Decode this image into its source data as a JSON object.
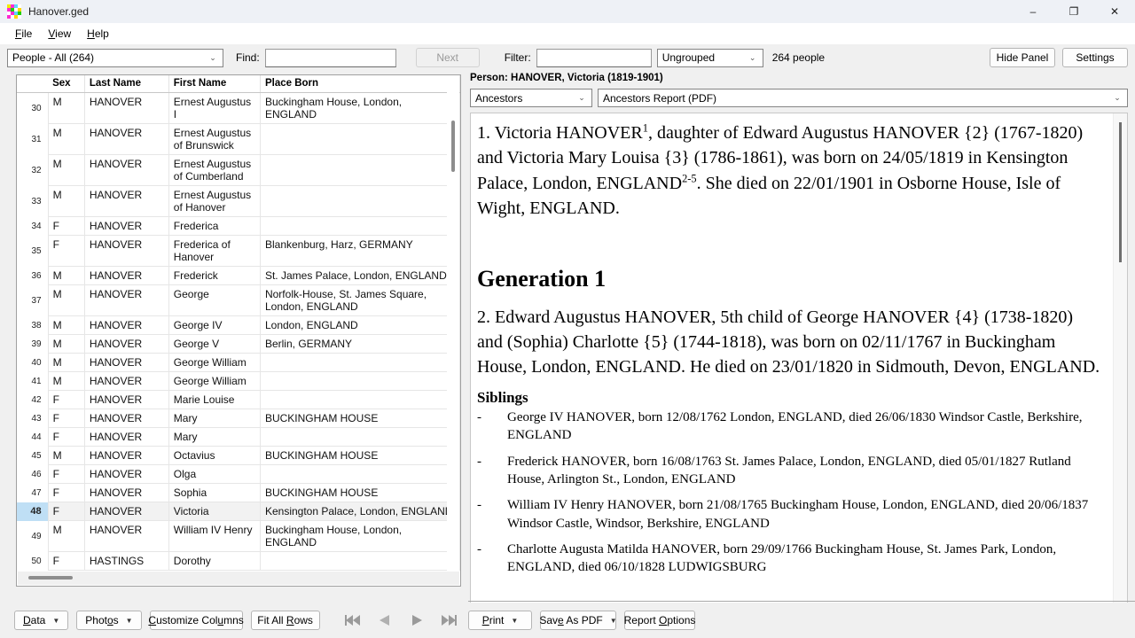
{
  "window": {
    "title": "Hanover.ged",
    "icon": "gedcom-grid-icon",
    "minimize": "–",
    "maximize": "❐",
    "close": "✕"
  },
  "menubar": {
    "items": [
      {
        "label": "File",
        "accel": "F"
      },
      {
        "label": "View",
        "accel": "V"
      },
      {
        "label": "Help",
        "accel": "H"
      }
    ]
  },
  "toolbar": {
    "people_selector": "People - All (264)",
    "find_label": "Find:",
    "find_value": "",
    "next_label": "Next",
    "filter_label": "Filter:",
    "filter_value": "",
    "group_selector": "Ungrouped",
    "people_count": "264 people",
    "hide_panel_label": "Hide Panel",
    "settings_label": "Settings"
  },
  "grid": {
    "columns": [
      "",
      "Sex",
      "Last Name",
      "First Name",
      "Place Born"
    ],
    "sorted_column": "Last Name",
    "sort_direction": "ascending",
    "selected_row_index": 48,
    "rows": [
      {
        "idx": "30",
        "sex": "M",
        "last": "HANOVER",
        "first": "Ernest Augustus I",
        "place": "Buckingham House, London, ENGLAND"
      },
      {
        "idx": "31",
        "sex": "M",
        "last": "HANOVER",
        "first": "Ernest Augustus of Brunswick",
        "place": ""
      },
      {
        "idx": "32",
        "sex": "M",
        "last": "HANOVER",
        "first": "Ernest Augustus of Cumberland",
        "place": ""
      },
      {
        "idx": "33",
        "sex": "M",
        "last": "HANOVER",
        "first": "Ernest Augustus of Hanover",
        "place": ""
      },
      {
        "idx": "34",
        "sex": "F",
        "last": "HANOVER",
        "first": "Frederica",
        "place": ""
      },
      {
        "idx": "35",
        "sex": "F",
        "last": "HANOVER",
        "first": "Frederica of Hanover",
        "place": "Blankenburg, Harz, GERMANY"
      },
      {
        "idx": "36",
        "sex": "M",
        "last": "HANOVER",
        "first": "Frederick",
        "place": "St. James Palace, London, ENGLAND"
      },
      {
        "idx": "37",
        "sex": "M",
        "last": "HANOVER",
        "first": "George",
        "place": "Norfolk-House, St. James Square, London, ENGLAND"
      },
      {
        "idx": "38",
        "sex": "M",
        "last": "HANOVER",
        "first": "George IV",
        "place": "London, ENGLAND"
      },
      {
        "idx": "39",
        "sex": "M",
        "last": "HANOVER",
        "first": "George V",
        "place": "Berlin, GERMANY"
      },
      {
        "idx": "40",
        "sex": "M",
        "last": "HANOVER",
        "first": "George William",
        "place": ""
      },
      {
        "idx": "41",
        "sex": "M",
        "last": "HANOVER",
        "first": "George William",
        "place": ""
      },
      {
        "idx": "42",
        "sex": "F",
        "last": "HANOVER",
        "first": "Marie Louise",
        "place": ""
      },
      {
        "idx": "43",
        "sex": "F",
        "last": "HANOVER",
        "first": "Mary",
        "place": "BUCKINGHAM HOUSE"
      },
      {
        "idx": "44",
        "sex": "F",
        "last": "HANOVER",
        "first": "Mary",
        "place": ""
      },
      {
        "idx": "45",
        "sex": "M",
        "last": "HANOVER",
        "first": "Octavius",
        "place": "BUCKINGHAM HOUSE"
      },
      {
        "idx": "46",
        "sex": "F",
        "last": "HANOVER",
        "first": "Olga",
        "place": ""
      },
      {
        "idx": "47",
        "sex": "F",
        "last": "HANOVER",
        "first": "Sophia",
        "place": "BUCKINGHAM HOUSE"
      },
      {
        "idx": "48",
        "sex": "F",
        "last": "HANOVER",
        "first": "Victoria",
        "place": "Kensington Palace, London, ENGLAND",
        "selected": true
      },
      {
        "idx": "49",
        "sex": "M",
        "last": "HANOVER",
        "first": "William IV Henry",
        "place": "Buckingham House, London, ENGLAND"
      },
      {
        "idx": "50",
        "sex": "F",
        "last": "HASTINGS",
        "first": "Dorothy",
        "place": ""
      }
    ]
  },
  "report": {
    "person_header": "Person: HANOVER, Victoria (1819-1901)",
    "view_selector": "Ancestors",
    "format_selector": "Ancestors Report (PDF)",
    "intro_number": "1.",
    "intro_text_a": "1. Victoria HANOVER",
    "intro_sup_a": "1",
    "intro_text_b": ", daughter of Edward Augustus HANOVER {2} (1767-1820) and Victoria Mary Louisa {3} (1786-1861), was born on 24/05/1819 in Kensington Palace, London, ENGLAND",
    "intro_sup_b": "2-5",
    "intro_text_c": ". She died on 22/01/1901 in Osborne House, Isle of Wight, ENGLAND.",
    "generation_heading": "Generation 1",
    "generation_para": "2. Edward Augustus HANOVER, 5th child of George HANOVER {4} (1738-1820) and (Sophia) Charlotte {5} (1744-1818), was born on 02/11/1767 in Buckingham House, London, ENGLAND. He died on 23/01/1820 in Sidmouth, Devon, ENGLAND.",
    "siblings_heading": "Siblings",
    "sibling_bullet": "-",
    "siblings": [
      "George IV HANOVER, born 12/08/1762 London, ENGLAND, died 26/06/1830 Windsor Castle, Berkshire, ENGLAND",
      "Frederick HANOVER, born 16/08/1763 St. James Palace, London, ENGLAND, died 05/01/1827 Rutland House, Arlington St., London, ENGLAND",
      "William IV Henry HANOVER, born 21/08/1765 Buckingham House, London, ENGLAND, died 20/06/1837 Windsor Castle, Windsor, Berkshire, ENGLAND",
      "Charlotte Augusta Matilda HANOVER, born 29/09/1766 Buckingham House, St. James Park, London, ENGLAND, died 06/10/1828 LUDWIGSBURG"
    ]
  },
  "bottom_left": {
    "data_label": "Data",
    "photos_label": "Photos",
    "customize_columns_label": "Customize Columns",
    "fit_all_rows_label": "Fit All Rows",
    "nav_first": "first-record-icon",
    "nav_prev": "previous-record-icon",
    "nav_next": "next-record-icon",
    "nav_last": "last-record-icon"
  },
  "bottom_right": {
    "print_label": "Print",
    "save_as_pdf_label": "Save As PDF",
    "report_options_label": "Report Options"
  },
  "colors": {
    "selection_blue": "#bfdff5",
    "titlebar": "#eef1f6",
    "chrome": "#f0f0f0"
  }
}
